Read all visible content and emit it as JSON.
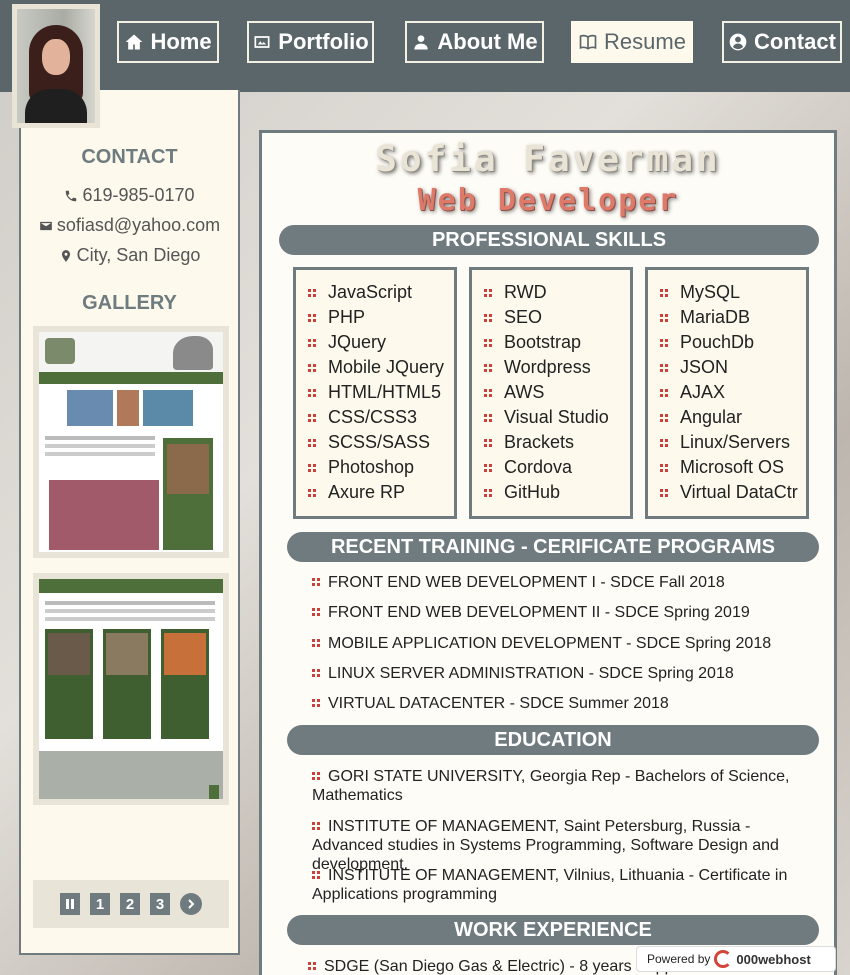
{
  "nav": {
    "items": [
      {
        "label": "Home",
        "icon": "home-icon"
      },
      {
        "label": "Portfolio",
        "icon": "image-icon"
      },
      {
        "label": "About Me",
        "icon": "user-icon"
      },
      {
        "label": "Resume",
        "icon": "book-icon",
        "active": true
      },
      {
        "label": "Contact",
        "icon": "user-circle-icon"
      }
    ]
  },
  "sidebar": {
    "contact_heading": "CONTACT",
    "phone": "619-985-0170",
    "email": "sofiasd@yahoo.com",
    "city": "City, San Diego",
    "gallery_heading": "GALLERY",
    "pager": [
      "1",
      "2",
      "3"
    ]
  },
  "resume": {
    "name": "Sofia Faverman",
    "title": "Web Developer",
    "skills_heading": "PROFESSIONAL SKILLS",
    "skills": [
      [
        "JavaScript",
        "PHP",
        "JQuery",
        "Mobile JQuery",
        "HTML/HTML5",
        "CSS/CSS3",
        "SCSS/SASS",
        "Photoshop",
        "Axure RP"
      ],
      [
        "RWD",
        "SEO",
        "Bootstrap",
        "Wordpress",
        "AWS",
        "Visual Studio",
        "Brackets",
        "Cordova",
        "GitHub"
      ],
      [
        "MySQL",
        "MariaDB",
        "PouchDb",
        "JSON",
        "AJAX",
        "Angular",
        "Linux/Servers",
        "Microsoft OS",
        "Virtual DataCtr"
      ]
    ],
    "training_heading": "RECENT TRAINING - CERIFICATE PROGRAMS",
    "training": [
      "FRONT END WEB DEVELOPMENT I - SDCE Fall 2018",
      "FRONT END WEB DEVELOPMENT II - SDCE Spring 2019",
      "MOBILE APPLICATION DEVELOPMENT - SDCE Spring 2018",
      "LINUX SERVER ADMINISTRATION - SDCE Spring 2018",
      "VIRTUAL DATACENTER - SDCE Summer 2018"
    ],
    "education_heading": "EDUCATION",
    "education": [
      "GORI STATE UNIVERSITY, Georgia Rep - Bachelors of Science, Mathematics",
      "INSTITUTE OF MANAGEMENT, Saint Petersburg, Russia - Advanced studies in Systems Programming, Software Design and development.",
      "INSTITUTE OF MANAGEMENT, Vilnius, Lithuania - Certificate in Applications programming"
    ],
    "work_heading": "WORK EXPERIENCE",
    "work": [
      "SDGE (San Diego Gas & Electric) - 8 years - Application development"
    ]
  },
  "badge": {
    "prefix": "Powered by",
    "brand": "000webhost"
  },
  "colors": {
    "header": "#5b666a",
    "accent": "#6f7b7f",
    "cream": "#fdf9ec",
    "title": "#dd7a6a",
    "bullet": "#c9413a"
  }
}
